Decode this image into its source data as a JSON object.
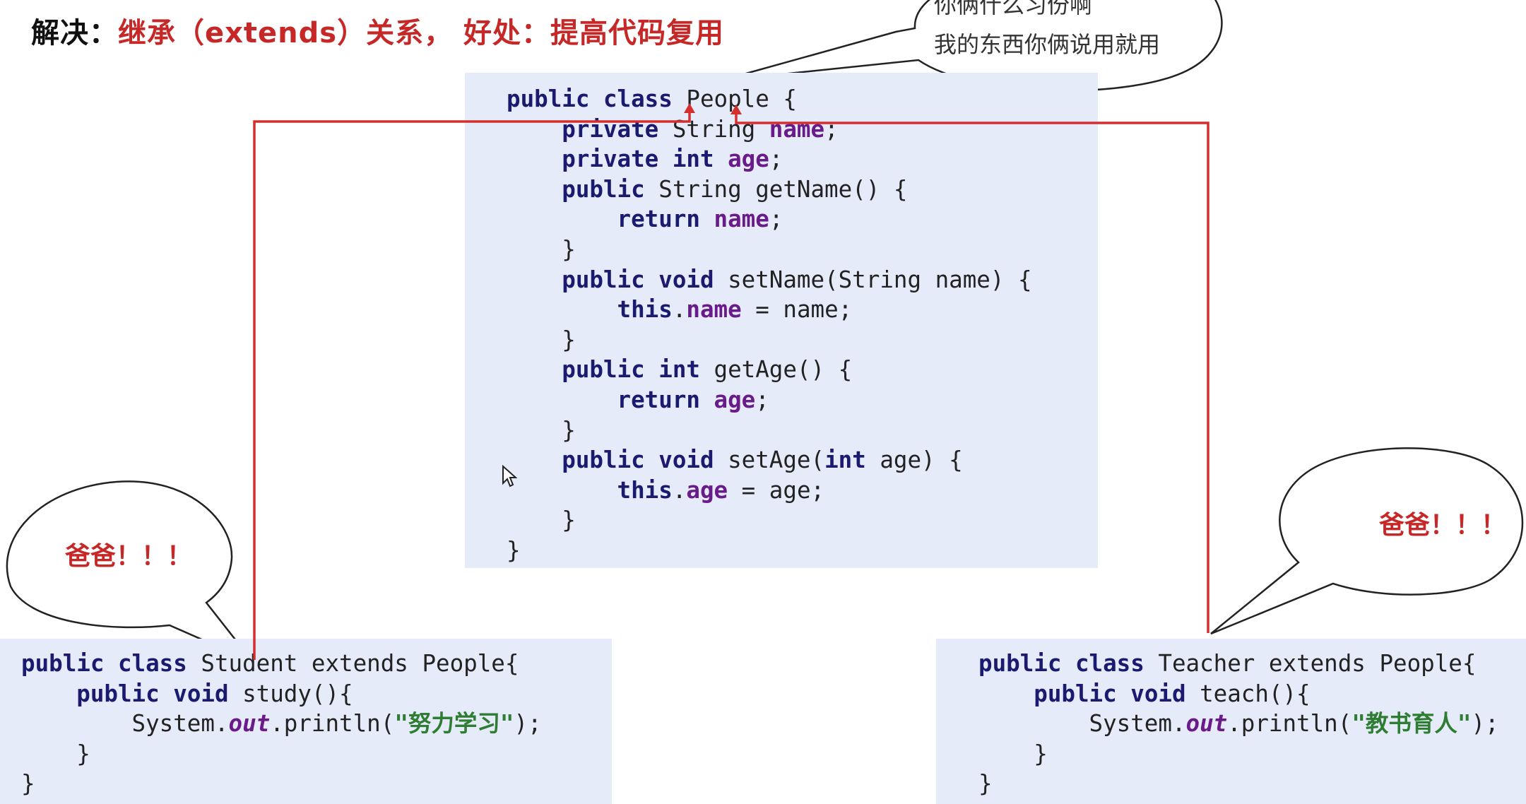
{
  "heading": {
    "lead": "解决：",
    "text": "继承（extends）关系， 好处：提高代码复用"
  },
  "bubbles": {
    "top_line1": "你俩什么习份啊",
    "top_line2": "我的东西你俩说用就用",
    "left": "爸爸！！！",
    "right": "爸爸！！！"
  },
  "people_code": [
    [
      {
        "t": "public class",
        "c": "kw"
      },
      {
        "t": " People {",
        "c": ""
      }
    ],
    [
      {
        "t": "    ",
        "c": ""
      },
      {
        "t": "private",
        "c": "kw"
      },
      {
        "t": " String ",
        "c": ""
      },
      {
        "t": "name",
        "c": "fld"
      },
      {
        "t": ";",
        "c": ""
      }
    ],
    [
      {
        "t": "    ",
        "c": ""
      },
      {
        "t": "private int",
        "c": "kw"
      },
      {
        "t": " ",
        "c": ""
      },
      {
        "t": "age",
        "c": "fld"
      },
      {
        "t": ";",
        "c": ""
      }
    ],
    [
      {
        "t": "    ",
        "c": ""
      },
      {
        "t": "public",
        "c": "kw"
      },
      {
        "t": " String getName() {",
        "c": ""
      }
    ],
    [
      {
        "t": "        ",
        "c": ""
      },
      {
        "t": "return",
        "c": "kw"
      },
      {
        "t": " ",
        "c": ""
      },
      {
        "t": "name",
        "c": "fld"
      },
      {
        "t": ";",
        "c": ""
      }
    ],
    [
      {
        "t": "    }",
        "c": ""
      }
    ],
    [
      {
        "t": "    ",
        "c": ""
      },
      {
        "t": "public void",
        "c": "kw"
      },
      {
        "t": " setName(String name) {",
        "c": ""
      }
    ],
    [
      {
        "t": "        ",
        "c": ""
      },
      {
        "t": "this",
        "c": "kw"
      },
      {
        "t": ".",
        "c": ""
      },
      {
        "t": "name",
        "c": "fld"
      },
      {
        "t": " = name;",
        "c": ""
      }
    ],
    [
      {
        "t": "    }",
        "c": ""
      }
    ],
    [
      {
        "t": "    ",
        "c": ""
      },
      {
        "t": "public int",
        "c": "kw"
      },
      {
        "t": " getAge() {",
        "c": ""
      }
    ],
    [
      {
        "t": "        ",
        "c": ""
      },
      {
        "t": "return",
        "c": "kw"
      },
      {
        "t": " ",
        "c": ""
      },
      {
        "t": "age",
        "c": "fld"
      },
      {
        "t": ";",
        "c": ""
      }
    ],
    [
      {
        "t": "    }",
        "c": ""
      }
    ],
    [
      {
        "t": "    ",
        "c": ""
      },
      {
        "t": "public void",
        "c": "kw"
      },
      {
        "t": " setAge(",
        "c": ""
      },
      {
        "t": "int",
        "c": "kw"
      },
      {
        "t": " age) {",
        "c": ""
      }
    ],
    [
      {
        "t": "        ",
        "c": ""
      },
      {
        "t": "this",
        "c": "kw"
      },
      {
        "t": ".",
        "c": ""
      },
      {
        "t": "age",
        "c": "fld"
      },
      {
        "t": " = age;",
        "c": ""
      }
    ],
    [
      {
        "t": "    }",
        "c": ""
      }
    ],
    [
      {
        "t": "}",
        "c": ""
      }
    ]
  ],
  "student_code": [
    [
      {
        "t": "public class",
        "c": "kw"
      },
      {
        "t": " Student extends People{",
        "c": ""
      }
    ],
    [
      {
        "t": "    ",
        "c": ""
      },
      {
        "t": "public void",
        "c": "kw"
      },
      {
        "t": " study(){",
        "c": ""
      }
    ],
    [
      {
        "t": "        System.",
        "c": ""
      },
      {
        "t": "out",
        "c": "stat"
      },
      {
        "t": ".println(",
        "c": ""
      },
      {
        "t": "\"努力学习\"",
        "c": "str"
      },
      {
        "t": ");",
        "c": ""
      }
    ],
    [
      {
        "t": "    }",
        "c": ""
      }
    ],
    [
      {
        "t": "}",
        "c": ""
      }
    ]
  ],
  "teacher_code": [
    [
      {
        "t": "public class",
        "c": "kw"
      },
      {
        "t": " Teacher extends People{",
        "c": ""
      }
    ],
    [
      {
        "t": "    ",
        "c": ""
      },
      {
        "t": "public void",
        "c": "kw"
      },
      {
        "t": " teach(){",
        "c": ""
      }
    ],
    [
      {
        "t": "        System.",
        "c": ""
      },
      {
        "t": "out",
        "c": "stat"
      },
      {
        "t": ".println(",
        "c": ""
      },
      {
        "t": "\"教书育人\"",
        "c": "str"
      },
      {
        "t": ");",
        "c": ""
      }
    ],
    [
      {
        "t": "    }",
        "c": ""
      }
    ],
    [
      {
        "t": "}",
        "c": ""
      }
    ]
  ],
  "colors": {
    "arrow": "#d32f2f",
    "code_bg": "#e6ebfa",
    "keyword": "#1a1a6e",
    "field": "#6a1b8a",
    "string": "#2e7d32",
    "heading_red": "#c62828"
  }
}
